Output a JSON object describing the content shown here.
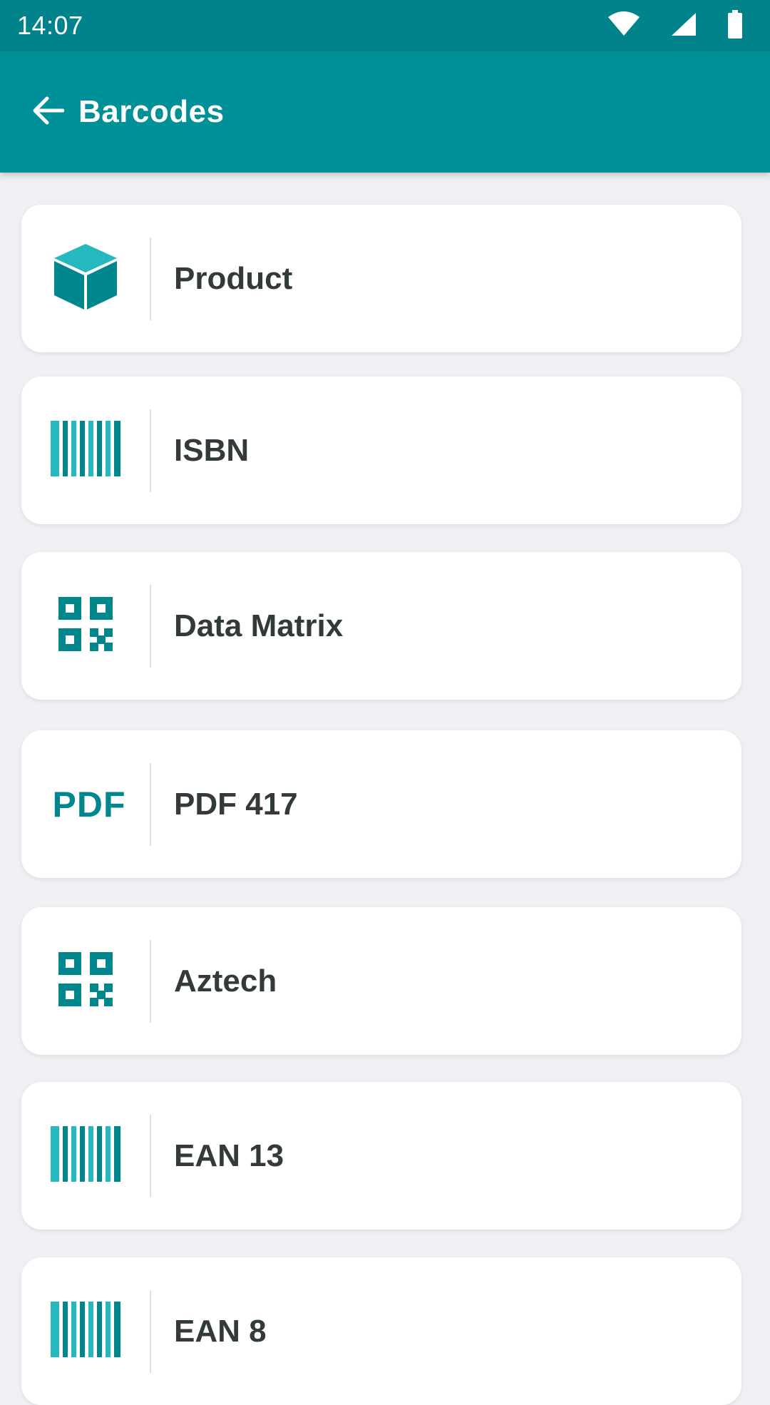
{
  "status_bar": {
    "time": "14:07",
    "icons": [
      "wifi-icon",
      "cell-signal-icon",
      "battery-icon"
    ]
  },
  "app_bar": {
    "title": "Barcodes",
    "back_icon": "arrow-left-icon"
  },
  "colors": {
    "status_bar": "#00838a",
    "app_bar": "#009097",
    "accent_dark": "#00868d",
    "accent_light": "#26b8bf",
    "background": "#eef0f4",
    "card": "#ffffff",
    "text": "#333a3a"
  },
  "items": [
    {
      "label": "Product",
      "icon": "cube-icon"
    },
    {
      "label": "ISBN",
      "icon": "barcode-icon"
    },
    {
      "label": "Data Matrix",
      "icon": "qr-code-icon"
    },
    {
      "label": "PDF 417",
      "icon": "pdf-icon",
      "icon_text": "PDF"
    },
    {
      "label": "Aztech",
      "icon": "qr-code-icon"
    },
    {
      "label": "EAN 13",
      "icon": "barcode-icon"
    },
    {
      "label": "EAN 8",
      "icon": "barcode-icon"
    }
  ]
}
